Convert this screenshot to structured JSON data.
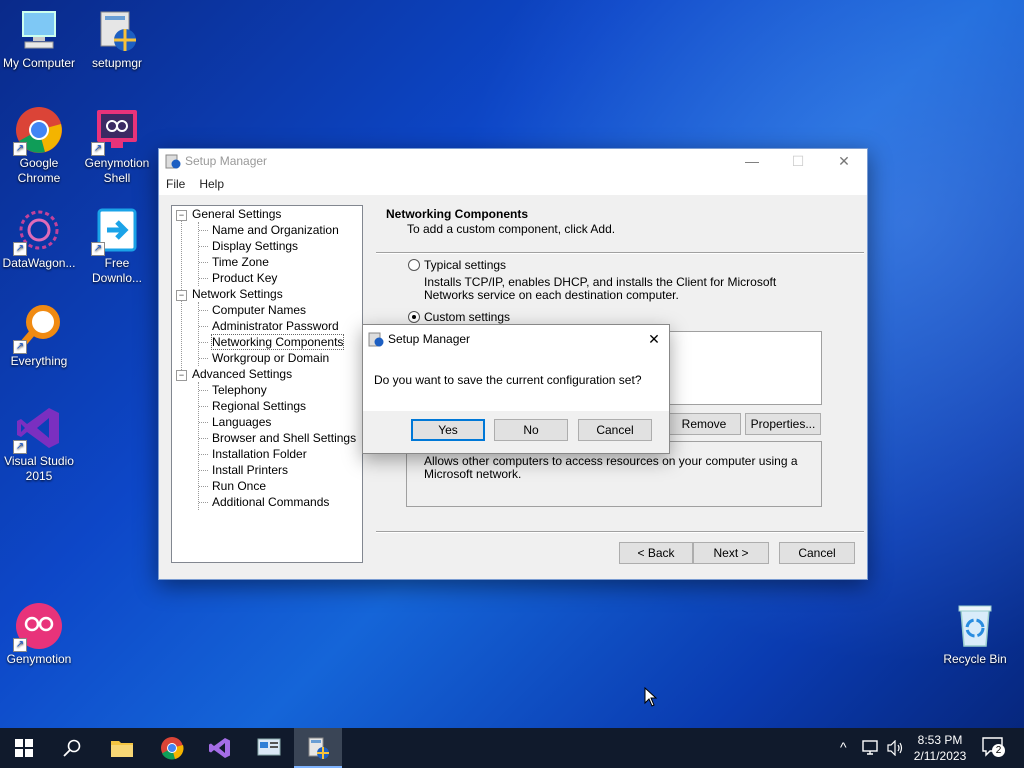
{
  "desktop": {
    "icons": [
      {
        "label": "My Computer"
      },
      {
        "label": "setupmgr"
      },
      {
        "label": "Google Chrome"
      },
      {
        "label": "Genymotion Shell"
      },
      {
        "label": "DataWagon..."
      },
      {
        "label": "Free Downlo..."
      },
      {
        "label": "Everything"
      },
      {
        "label": "Visual Studio 2015"
      },
      {
        "label": "Genymotion"
      },
      {
        "label": "Recycle Bin"
      }
    ]
  },
  "window": {
    "title": "Setup Manager",
    "menu": [
      "File",
      "Help"
    ],
    "tree": [
      {
        "label": "General Settings"
      },
      {
        "label": "Name and Organization"
      },
      {
        "label": "Display Settings"
      },
      {
        "label": "Time Zone"
      },
      {
        "label": "Product Key"
      },
      {
        "label": "Network Settings"
      },
      {
        "label": "Computer Names"
      },
      {
        "label": "Administrator Password"
      },
      {
        "label": "Networking Components"
      },
      {
        "label": "Workgroup or Domain"
      },
      {
        "label": "Advanced Settings"
      },
      {
        "label": "Telephony"
      },
      {
        "label": "Regional Settings"
      },
      {
        "label": "Languages"
      },
      {
        "label": "Browser and Shell Settings"
      },
      {
        "label": "Installation Folder"
      },
      {
        "label": "Install Printers"
      },
      {
        "label": "Run Once"
      },
      {
        "label": "Additional Commands"
      }
    ],
    "tree_toggle": "−",
    "page_title": "Networking Components",
    "page_subtitle": "To add a custom component, click Add.",
    "typical_label": "Typical settings",
    "typical_desc": "Installs TCP/IP, enables DHCP, and installs the Client for Microsoft Networks service on each destination computer.",
    "custom_label": "Custom settings",
    "remove_button": "Remove",
    "properties_button": "Properties...",
    "component_desc": "Allows other computers to access resources on your computer using a Microsoft network.",
    "back_button": "< Back",
    "next_button": "Next >",
    "cancel_button": "Cancel",
    "controls": {
      "minimize": "—",
      "maximize": "☐",
      "close": "✕"
    }
  },
  "dialog": {
    "title": "Setup Manager",
    "message": "Do you want to save the current configuration set?",
    "yes": "Yes",
    "no": "No",
    "cancel": "Cancel",
    "close": "✕"
  },
  "taskbar": {
    "time": "8:53 PM",
    "date": "2/11/2023",
    "notification_count": "2",
    "chevron": "^"
  },
  "colors": {
    "accent": "#0078d7",
    "taskbar": "#101a2c",
    "selected": "#0078d7"
  }
}
